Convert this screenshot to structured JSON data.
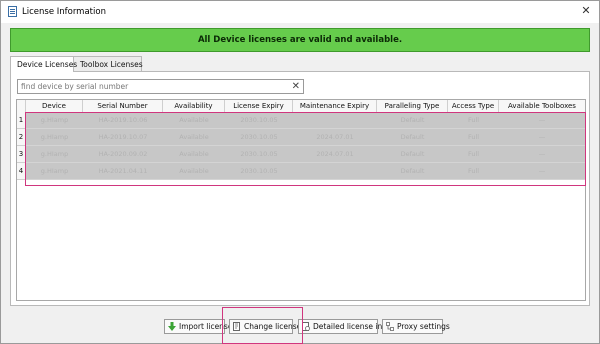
{
  "window": {
    "title": "License Information",
    "close_glyph": "✕"
  },
  "banner": {
    "text": "All Device licenses are valid and available.",
    "color": "#66cc4c"
  },
  "tabs": [
    {
      "label": "Device Licenses",
      "active": true
    },
    {
      "label": "Toolbox Licenses",
      "active": false
    }
  ],
  "search": {
    "placeholder": "find device by serial number",
    "value": "",
    "clear_glyph": "✕"
  },
  "table": {
    "columns": [
      "Device",
      "Serial Number",
      "Availability",
      "License Expiry",
      "Maintenance Expiry",
      "Paralleling Type",
      "Access Type",
      "Available Toolboxes"
    ],
    "row_numbers": [
      "1",
      "2",
      "3",
      "4"
    ],
    "rows": [
      [
        "g.HIamp",
        "HA-2019.10.06",
        "Available",
        "2030.10.05",
        "",
        "Default",
        "Full",
        "—"
      ],
      [
        "g.HIamp",
        "HA-2019.10.07",
        "Available",
        "2030.10.05",
        "2024.07.01",
        "Default",
        "Full",
        "—"
      ],
      [
        "g.HIamp",
        "HA-2020.09.02",
        "Available",
        "2030.10.05",
        "2024.07.01",
        "Default",
        "Full",
        "—"
      ],
      [
        "g.HIamp",
        "HA-2021.04.11",
        "Available",
        "2030.10.05",
        "",
        "Default",
        "Full",
        "—"
      ]
    ],
    "selection_color": "#d0367e",
    "row_fill": "#c7c7c7"
  },
  "buttons": {
    "import": {
      "label": "Import license",
      "icon": "green-down-arrow-icon"
    },
    "change": {
      "label": "Change license",
      "icon": "license-edit-icon"
    },
    "detailed": {
      "label": "Detailed license info",
      "icon": "license-info-icon"
    },
    "proxy": {
      "label": "Proxy settings",
      "icon": "network-icon"
    }
  }
}
